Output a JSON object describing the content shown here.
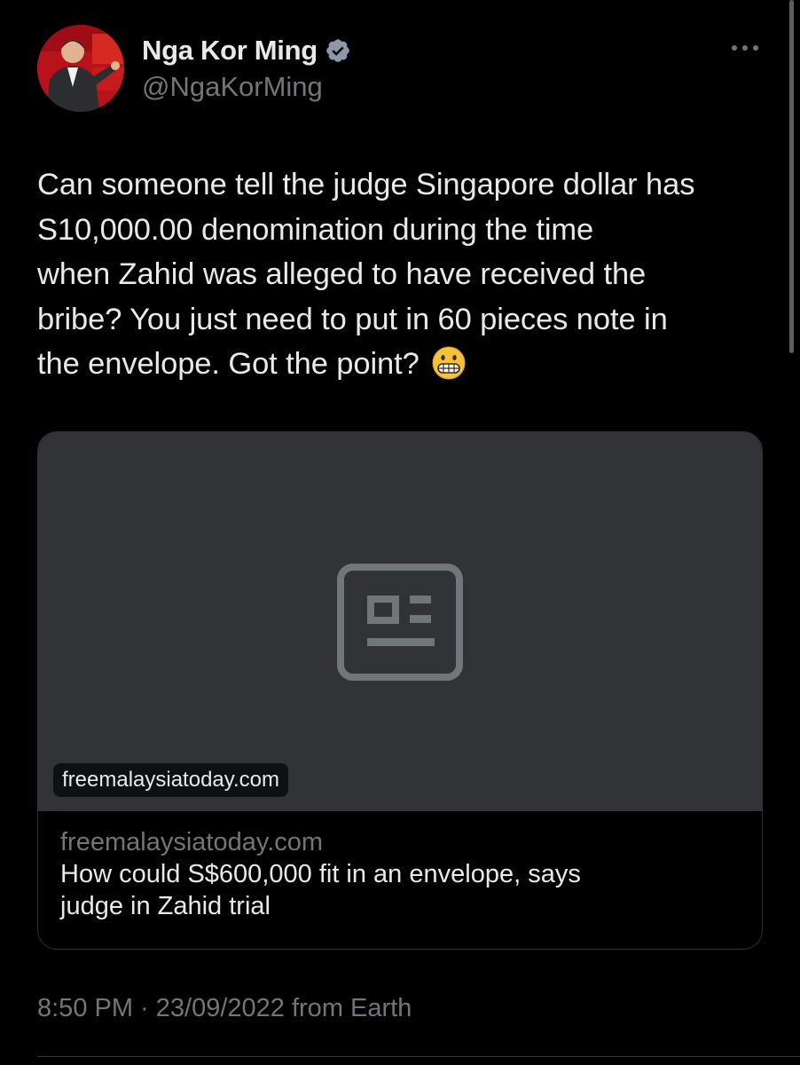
{
  "author": {
    "display_name": "Nga Kor Ming",
    "handle": "@NgaKorMing",
    "verified": true,
    "avatar_icon": "profile-photo"
  },
  "more_icon": "ellipsis-icon",
  "tweet": {
    "lines": [
      "Can someone tell the judge Singapore dollar has",
      "S10,000.00 denomination during the time",
      "when Zahid was alleged to have received the",
      "bribe? You just need to put in 60 pieces note in",
      "the envelope. Got the point?"
    ],
    "emoji": "grimacing-face"
  },
  "link_card": {
    "media_icon": "article-icon",
    "chip_domain": "freemalaysiatoday.com",
    "domain": "freemalaysiatoday.com",
    "title_lines": [
      "How could S$600,000 fit in an envelope, says",
      "judge in Zahid trial"
    ]
  },
  "timestamp": "8:50 PM · 23/09/2022 from Earth",
  "colors": {
    "background": "#000000",
    "text_primary": "#e7e9ea",
    "text_secondary": "#71767b",
    "card_media": "#313336",
    "verified_badge": "#8b98a5"
  }
}
